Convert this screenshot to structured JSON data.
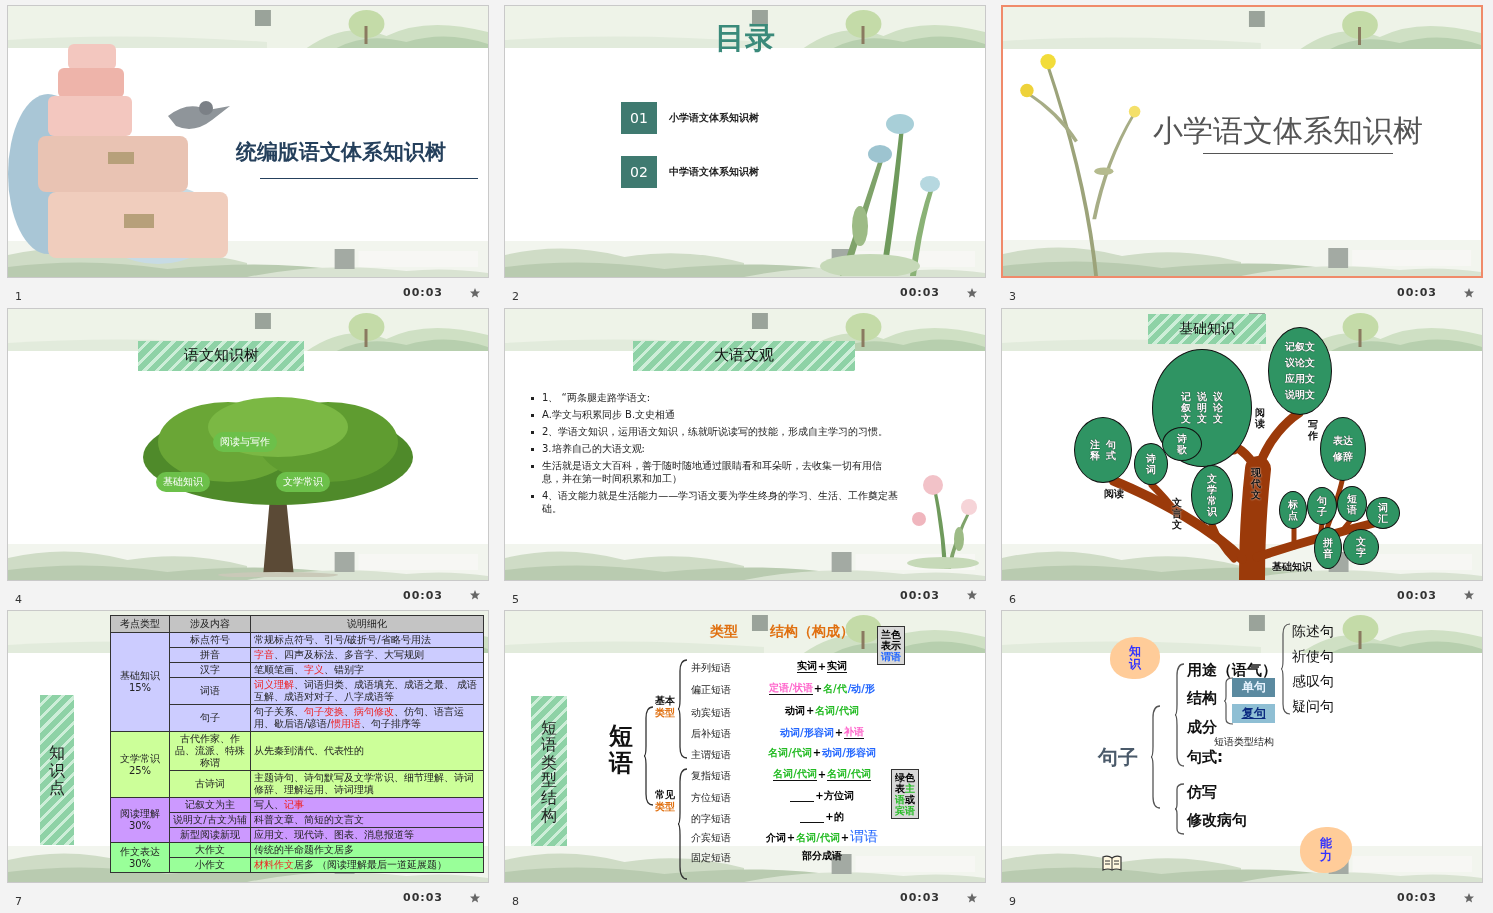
{
  "slides": [
    {
      "number": "1",
      "time": "00:03",
      "selected": false,
      "kind": "title",
      "title": "统编版语文体系知识树"
    },
    {
      "number": "2",
      "time": "00:03",
      "selected": false,
      "kind": "contents",
      "title": "目录",
      "items": [
        {
          "index": "01",
          "label": "小学语文体系知识树"
        },
        {
          "index": "02",
          "label": "中学语文体系知识树"
        }
      ]
    },
    {
      "number": "3",
      "time": "00:03",
      "selected": true,
      "kind": "section",
      "title": "小学语文体系知识树"
    },
    {
      "number": "4",
      "time": "00:03",
      "selected": false,
      "kind": "tree",
      "title": "语文知识树",
      "labels": [
        "阅读与写作",
        "基础知识",
        "文学常识"
      ]
    },
    {
      "number": "5",
      "time": "00:03",
      "selected": false,
      "kind": "bullets",
      "title": "大语文观",
      "bullets": [
        "1、 “两条腿走路学语文:",
        "A.学文与积累同步  B.文史相通",
        "2、学语文知识，运用语文知识，练就听说读写的技能，形成自主学习的习惯。",
        "3.培养自己的大语文观:",
        "生活就是语文大百科，善于随时随地通过眼睛看和耳朵听，去收集一切有用信息，并在第一时间积累和加工）",
        "4、语文能力就是生活能力——学习语文要为学生终身的学习、生活、工作奠定基础。"
      ]
    },
    {
      "number": "6",
      "time": "00:03",
      "selected": false,
      "kind": "knowledge_tree",
      "title": "基础知识",
      "leaves": [
        {
          "lines": [
            "记叙文",
            "说明文",
            "议论文"
          ],
          "vertical": true
        },
        {
          "lines": [
            "记叙文",
            "议论文",
            "应用文",
            "说明文"
          ],
          "vertical": false
        },
        {
          "lines": [
            "注释",
            "句式"
          ],
          "vertical": true
        },
        {
          "lines": [
            "诗词"
          ],
          "vertical": true
        },
        {
          "lines": [
            "诗歌"
          ],
          "vertical": true
        },
        {
          "lines": [
            "文学常识"
          ],
          "vertical": true
        },
        {
          "lines": [
            "表达",
            "修辞"
          ],
          "vertical": false
        },
        {
          "lines": [
            "标点"
          ],
          "vertical": true
        },
        {
          "lines": [
            "句子"
          ],
          "vertical": true
        },
        {
          "lines": [
            "短语"
          ],
          "vertical": true
        },
        {
          "lines": [
            "词汇"
          ],
          "vertical": true
        },
        {
          "lines": [
            "拼音"
          ],
          "vertical": true
        },
        {
          "lines": [
            "文字"
          ],
          "vertical": true
        }
      ],
      "branch_labels": [
        {
          "text": "阅读",
          "vertical": true
        },
        {
          "text": "写作",
          "vertical": true
        },
        {
          "text": "阅读",
          "vertical": false
        },
        {
          "text": "文言文",
          "vertical": true
        },
        {
          "text": "现代文",
          "vertical": true
        },
        {
          "text": "基础知识",
          "vertical": false
        }
      ]
    },
    {
      "number": "7",
      "time": "00:03",
      "selected": false,
      "kind": "table",
      "side_title": "知识点",
      "columns": [
        "考点类型",
        "涉及内容",
        "说明细化"
      ],
      "groups": [
        {
          "label": "基础知识\n15%",
          "color": "#ccccff",
          "rows": [
            {
              "topic": "标点符号",
              "detail": [
                {
                  "text": "常规标点符号、引号/破折号/省略号用法",
                  "highlight": false
                }
              ]
            },
            {
              "topic": "拼音",
              "detail": [
                {
                  "text": "字音",
                  "highlight": true
                },
                {
                  "text": "、四声及标法、多音字、大写规则",
                  "highlight": false
                }
              ]
            },
            {
              "topic": "汉字",
              "detail": [
                {
                  "text": "笔顺笔画、",
                  "highlight": false
                },
                {
                  "text": "字义",
                  "highlight": true
                },
                {
                  "text": "、错别字",
                  "highlight": false
                }
              ]
            },
            {
              "topic": "词语",
              "detail": [
                {
                  "text": "词义理解",
                  "highlight": true
                },
                {
                  "text": "、词语归类、成语填充、成语之最、 成语互解、成语对对子、八字成语等",
                  "highlight": false
                }
              ]
            },
            {
              "topic": "句子",
              "detail": [
                {
                  "text": "句子关系、",
                  "highlight": false
                },
                {
                  "text": "句子变换",
                  "highlight": true
                },
                {
                  "text": "、",
                  "highlight": false
                },
                {
                  "text": "病句修改",
                  "highlight": true
                },
                {
                  "text": "、仿句、语言运用、歇后语/谚语/",
                  "highlight": false
                },
                {
                  "text": "惯用语",
                  "highlight": true
                },
                {
                  "text": "、句子排序等",
                  "highlight": false
                }
              ]
            }
          ]
        },
        {
          "label": "文学常识25%",
          "color": "#ccff99",
          "rows": [
            {
              "topic": "古代作家、作品、流派、特殊称谓",
              "detail": [
                {
                  "text": "从先秦到清代、代表性的",
                  "highlight": false
                }
              ]
            },
            {
              "topic": "古诗词",
              "detail": [
                {
                  "text": "主题诗句、诗句默写及文学常识、细节理解、诗词修辞、理解运用、诗词理填",
                  "highlight": false
                }
              ]
            }
          ]
        },
        {
          "label": "阅读理解\n30%",
          "color": "#cc99ff",
          "rows": [
            {
              "topic": "记叙文为主",
              "detail": [
                {
                  "text": "写人、",
                  "highlight": false
                },
                {
                  "text": "记事",
                  "highlight": true
                }
              ]
            },
            {
              "topic": "说明文/古文为辅",
              "detail": [
                {
                  "text": "科普文章、简短的文言文",
                  "highlight": false
                }
              ]
            },
            {
              "topic": "新型阅读新现",
              "detail": [
                {
                  "text": "应用文、现代诗、图表、消息报道等",
                  "highlight": false
                }
              ]
            }
          ]
        },
        {
          "label": "作文表达30%",
          "color": "#99ff99",
          "rows": [
            {
              "topic": "大作文",
              "detail": [
                {
                  "text": "传统的半命题作文居多",
                  "highlight": false
                }
              ]
            },
            {
              "topic": "小作文",
              "detail": [
                {
                  "text": "材料作文",
                  "highlight": true
                },
                {
                  "text": "居多 （阅读理解最后一道延展题）",
                  "highlight": false
                }
              ]
            }
          ]
        }
      ]
    },
    {
      "number": "8",
      "time": "00:03",
      "selected": false,
      "kind": "phrases",
      "side_title": "短语类型结构",
      "main_label": "短语",
      "headers": [
        "类型",
        "结构（构成）"
      ],
      "callouts": [
        {
          "segments": [
            {
              "text": "兰色表示",
              "color": "#000000"
            },
            {
              "text": "谓语",
              "color": "#2266ff"
            }
          ]
        },
        {
          "segments": [
            {
              "text": "绿色表",
              "color": "#000000"
            },
            {
              "text": "主语",
              "color": "#22bb22"
            },
            {
              "text": "或",
              "color": "#000000"
            },
            {
              "text": "宾语",
              "color": "#22bb22"
            }
          ]
        }
      ],
      "groups": [
        {
          "label": "基本",
          "sublabel": "类型",
          "rows": [
            {
              "name": "并列短语",
              "structure": [
                {
                  "kind": "word",
                  "text": "实词",
                  "color": "#000000",
                  "underline": true
                },
                {
                  "kind": "word",
                  "text": "+",
                  "color": "#000000",
                  "underline": false
                },
                {
                  "kind": "word",
                  "text": "实词",
                  "color": "#000000",
                  "underline": true
                }
              ]
            },
            {
              "name": "偏正短语",
              "structure": [
                {
                  "kind": "word",
                  "text": "定语/状语",
                  "color": "#ff66cc",
                  "underline": true
                },
                {
                  "kind": "word",
                  "text": "+",
                  "color": "#000000",
                  "underline": false
                },
                {
                  "kind": "word",
                  "text": "名/代",
                  "color": "#22bb22",
                  "underline": false
                },
                {
                  "kind": "word",
                  "text": "/动/形",
                  "color": "#2266ff",
                  "underline": false
                }
              ]
            },
            {
              "name": "动宾短语",
              "structure": [
                {
                  "kind": "word",
                  "text": "动词",
                  "color": "#000000",
                  "underline": false
                },
                {
                  "kind": "word",
                  "text": "+",
                  "color": "#000000",
                  "underline": false
                },
                {
                  "kind": "word",
                  "text": "名词/代词",
                  "color": "#22bb22",
                  "underline": false
                }
              ]
            },
            {
              "name": "后补短语",
              "structure": [
                {
                  "kind": "word",
                  "text": "动词/形容词",
                  "color": "#2266ff",
                  "underline": false
                },
                {
                  "kind": "word",
                  "text": "+",
                  "color": "#000000",
                  "underline": false
                },
                {
                  "kind": "word",
                  "text": "补语",
                  "color": "#ff66cc",
                  "underline": true
                }
              ]
            },
            {
              "name": "主谓短语",
              "structure": [
                {
                  "kind": "word",
                  "text": "名词/代词",
                  "color": "#22bb22",
                  "underline": false
                },
                {
                  "kind": "word",
                  "text": "+",
                  "color": "#000000",
                  "underline": false
                },
                {
                  "kind": "word",
                  "text": "动词/形容词",
                  "color": "#2266ff",
                  "underline": false
                }
              ]
            }
          ]
        },
        {
          "label": "常见",
          "sublabel": "类型",
          "rows": [
            {
              "name": "复指短语",
              "structure": [
                {
                  "kind": "word",
                  "text": "名词/代词",
                  "color": "#22bb22",
                  "underline": true
                },
                {
                  "kind": "word",
                  "text": "+",
                  "color": "#000000",
                  "underline": false
                },
                {
                  "kind": "word",
                  "text": "名词/代词",
                  "color": "#22bb22",
                  "underline": true
                }
              ]
            },
            {
              "name": "方位短语",
              "structure": [
                {
                  "kind": "blank"
                },
                {
                  "kind": "word",
                  "text": "+方位词",
                  "color": "#000000",
                  "underline": false
                }
              ]
            },
            {
              "name": "的字短语",
              "structure": [
                {
                  "kind": "blank"
                },
                {
                  "kind": "word",
                  "text": "+的",
                  "color": "#000000",
                  "underline": false
                }
              ]
            },
            {
              "name": "介宾短语",
              "structure": [
                {
                  "kind": "word",
                  "text": "介词",
                  "color": "#000000",
                  "underline": false
                },
                {
                  "kind": "word",
                  "text": "+",
                  "color": "#000000",
                  "underline": false
                },
                {
                  "kind": "word",
                  "text": "名词/代词",
                  "color": "#22bb22",
                  "underline": false
                },
                {
                  "kind": "word",
                  "text": "+",
                  "color": "#000000",
                  "underline": false
                },
                {
                  "kind": "big_word",
                  "text": "谓语",
                  "color": "#2266ff"
                }
              ]
            },
            {
              "name": "固定短语",
              "structure": [
                {
                  "kind": "word",
                  "text": "部分成语",
                  "color": "#000000",
                  "underline": false
                }
              ]
            }
          ]
        }
      ]
    },
    {
      "number": "9",
      "time": "00:03",
      "selected": false,
      "kind": "sentence",
      "center": "句子",
      "clouds": [
        "知识",
        "能力"
      ],
      "groups": [
        {
          "items": [
            {
              "label": "用途（语气）"
            },
            {
              "label": "结构",
              "boxes": [
                {
                  "text": "单句",
                  "linked": false
                },
                {
                  "text": "复句",
                  "linked": true
                }
              ]
            },
            {
              "label": "成分",
              "note": "短语类型结构"
            },
            {
              "label": "句式:"
            }
          ]
        },
        {
          "items": [
            {
              "label": "仿写"
            },
            {
              "label": "修改病句"
            }
          ]
        }
      ],
      "moods": [
        "陈述句",
        "祈使句",
        "感叹句",
        "疑问句"
      ]
    }
  ]
}
